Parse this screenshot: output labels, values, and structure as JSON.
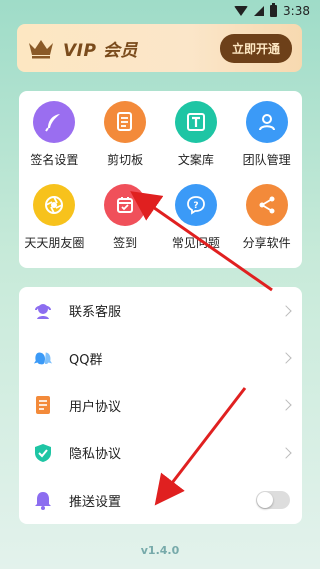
{
  "status_bar": {
    "time": "3:38"
  },
  "vip": {
    "title": "VIP 会员",
    "button_label": "立即开通"
  },
  "grid": [
    {
      "label": "签名设置",
      "icon": "feather-icon",
      "color": "#9a6ef0"
    },
    {
      "label": "剪切板",
      "icon": "clipboard-icon",
      "color": "#f38a3a"
    },
    {
      "label": "文案库",
      "icon": "text-icon",
      "color": "#1ec5a4"
    },
    {
      "label": "团队管理",
      "icon": "user-icon",
      "color": "#3b9af7"
    },
    {
      "label": "天天朋友圈",
      "icon": "aperture-icon",
      "color": "#f7c21c"
    },
    {
      "label": "签到",
      "icon": "calendar-check-icon",
      "color": "#f0505a"
    },
    {
      "label": "常见问题",
      "icon": "question-icon",
      "color": "#3b9af7"
    },
    {
      "label": "分享软件",
      "icon": "share-icon",
      "color": "#f38a3a"
    }
  ],
  "list": [
    {
      "label": "联系客服",
      "icon": "headset-icon",
      "color": "#8c6df0",
      "control": "chevron"
    },
    {
      "label": "QQ群",
      "icon": "qq-icon",
      "color": "#3b9af7",
      "control": "chevron"
    },
    {
      "label": "用户协议",
      "icon": "document-icon",
      "color": "#f38a3a",
      "control": "chevron"
    },
    {
      "label": "隐私协议",
      "icon": "shield-check-icon",
      "color": "#1ec5a4",
      "control": "chevron"
    },
    {
      "label": "推送设置",
      "icon": "bell-icon",
      "color": "#8c6df0",
      "control": "toggle",
      "toggle_on": false
    }
  ],
  "version": "v1.4.0",
  "annotation_color": "#e02020"
}
